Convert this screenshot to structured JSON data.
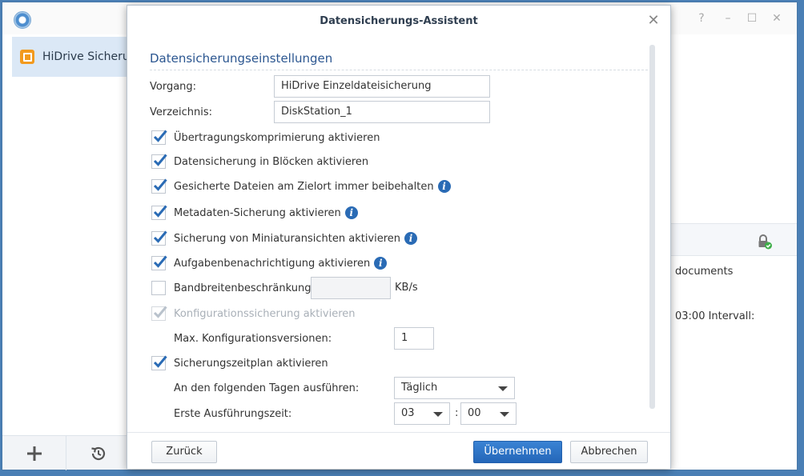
{
  "app": {
    "sidebar": {
      "items": [
        {
          "label": "HiDrive Sicherung"
        }
      ]
    },
    "window_controls": {
      "help": "?",
      "min": "–",
      "max": "☐",
      "close": "✕"
    },
    "right_panel": {
      "text_1": "documents",
      "text_2": "03:00 Intervall:"
    },
    "icons": {
      "logo": "backup-app-logo-icon",
      "add": "plus-icon",
      "restore": "restore-history-icon",
      "lock": "lock-check-icon"
    }
  },
  "dialog": {
    "title": "Datensicherungs-Assistent",
    "section_title": "Datensicherungseinstellungen",
    "fields": {
      "vorgang_label": "Vorgang:",
      "vorgang_value": "HiDrive Einzeldateisicherung",
      "verzeichnis_label": "Verzeichnis:",
      "verzeichnis_value": "DiskStation_1"
    },
    "options": [
      {
        "label": "Übertragungskomprimierung aktivieren",
        "checked": true,
        "info": false
      },
      {
        "label": "Datensicherung in Blöcken aktivieren",
        "checked": true,
        "info": false
      },
      {
        "label": "Gesicherte Dateien am Zielort immer beibehalten",
        "checked": true,
        "info": true
      },
      {
        "label": "Metadaten-Sicherung aktivieren",
        "checked": true,
        "info": true
      },
      {
        "label": "Sicherung von Miniaturansichten aktivieren",
        "checked": true,
        "info": true
      },
      {
        "label": "Aufgabenbenachrichtigung aktivieren",
        "checked": true,
        "info": true
      }
    ],
    "bandwidth": {
      "label": "Bandbreitenbeschränkung",
      "value": "",
      "unit": "KB/s",
      "checked": false
    },
    "config_backup": {
      "label": "Konfigurationssicherung aktivieren",
      "checked": true,
      "disabled": true
    },
    "max_versions": {
      "label": "Max. Konfigurationsversionen:",
      "value": "1"
    },
    "schedule": {
      "label": "Sicherungszeitplan aktivieren",
      "checked": true,
      "days_label": "An den folgenden Tagen ausführen:",
      "days_value": "Täglich",
      "time_label": "Erste Ausführungszeit:",
      "hour": "03",
      "separator": ":",
      "minute": "00"
    },
    "buttons": {
      "back": "Zurück",
      "apply": "Übernehmen",
      "cancel": "Abbrechen"
    },
    "colors": {
      "accent": "#2a6bb5",
      "title": "#2b5690",
      "check": "#2a6bb5",
      "check_disabled": "#b9c2cc"
    }
  }
}
